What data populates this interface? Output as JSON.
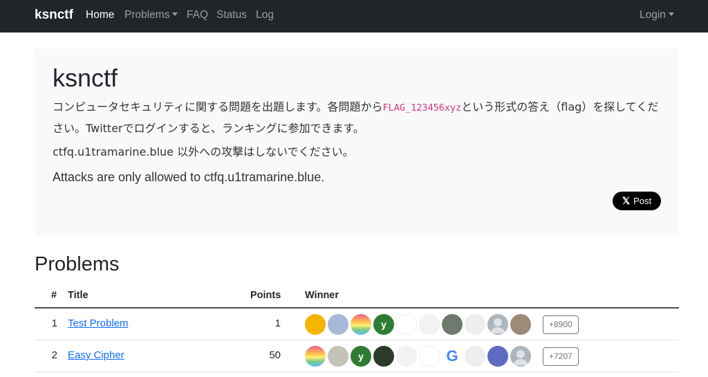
{
  "navbar": {
    "brand": "ksnctf",
    "items": [
      {
        "label": "Home"
      },
      {
        "label": "Problems"
      },
      {
        "label": "FAQ"
      },
      {
        "label": "Status"
      },
      {
        "label": "Log"
      }
    ],
    "login": "Login"
  },
  "jumbotron": {
    "title": "ksnctf",
    "desc_before": "コンピュータセキュリティに関する問題を出題します。各問題から",
    "flag_example": "FLAG_123456xyz",
    "desc_after": "という形式の答え（flag）を探してください。Twitterでログインすると、ランキングに参加できます。",
    "warning_ja": "ctfq.u1tramarine.blue 以外への攻撃はしないでください。",
    "warning_en": "Attacks are only allowed to ctfq.u1tramarine.blue.",
    "post_button": "Post",
    "post_icon": "x-logo-icon"
  },
  "problems": {
    "heading": "Problems",
    "columns": {
      "number": "#",
      "title": "Title",
      "points": "Points",
      "winner": "Winner"
    },
    "rows": [
      {
        "number": "1",
        "title": "Test Problem",
        "points": "1",
        "more": "+8900",
        "winners": [
          {
            "icon": "chick-avatar",
            "color": "#f4b400",
            "text": ""
          },
          {
            "icon": "anime-avatar",
            "color": "#a8b8d8",
            "text": ""
          },
          {
            "icon": "rainbow-avatar",
            "color": "#f06292",
            "text": ""
          },
          {
            "icon": "letter-avatar",
            "color": "#2e7d32",
            "text": "y"
          },
          {
            "icon": "bottles-avatar",
            "color": "#ffffff",
            "text": ""
          },
          {
            "icon": "sketch-avatar",
            "color": "#f2f2f2",
            "text": ""
          },
          {
            "icon": "photo-avatar",
            "color": "#6d7a6d",
            "text": ""
          },
          {
            "icon": "line-art-avatar",
            "color": "#eeeeee",
            "text": ""
          },
          {
            "icon": "default-user-avatar",
            "color": "#adb5bd",
            "text": ""
          },
          {
            "icon": "landscape-avatar",
            "color": "#9e8a78",
            "text": ""
          }
        ]
      },
      {
        "number": "2",
        "title": "Easy Cipher",
        "points": "50",
        "more": "+7207",
        "winners": [
          {
            "icon": "rainbow-avatar",
            "color": "#f06292",
            "text": ""
          },
          {
            "icon": "cat-avatar",
            "color": "#c7c2b8",
            "text": ""
          },
          {
            "icon": "letter-avatar",
            "color": "#2e7d32",
            "text": "y"
          },
          {
            "icon": "portrait-avatar",
            "color": "#2b3a2b",
            "text": ""
          },
          {
            "icon": "sketch-avatar",
            "color": "#f2f2f2",
            "text": ""
          },
          {
            "icon": "bottles-avatar",
            "color": "#ffffff",
            "text": ""
          },
          {
            "icon": "google-avatar",
            "color": "#ffffff",
            "text": "G"
          },
          {
            "icon": "line-art-avatar",
            "color": "#eeeeee",
            "text": ""
          },
          {
            "icon": "character-avatar",
            "color": "#5c6bc0",
            "text": ""
          },
          {
            "icon": "default-user-avatar",
            "color": "#adb5bd",
            "text": ""
          }
        ]
      }
    ]
  }
}
